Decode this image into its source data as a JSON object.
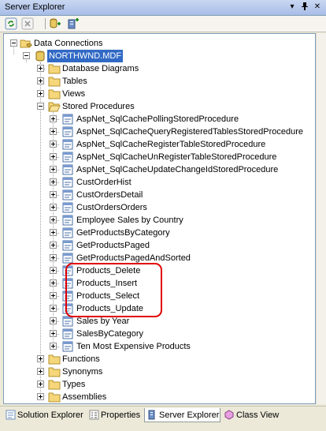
{
  "window": {
    "title": "Server Explorer"
  },
  "title_buttons": [
    "dropdown-icon",
    "pin-icon",
    "close-icon"
  ],
  "toolbar": {
    "buttons": [
      "refresh-icon",
      "stop-icon",
      "connect-database-icon",
      "connect-server-icon"
    ]
  },
  "tree": {
    "root": "Data Connections",
    "connection": "NORTHWND.MDF",
    "folders": {
      "database_diagrams": "Database Diagrams",
      "tables": "Tables",
      "views": "Views",
      "stored_procedures": "Stored Procedures",
      "functions": "Functions",
      "synonyms": "Synonyms",
      "types": "Types",
      "assemblies": "Assemblies"
    },
    "procedures": [
      "AspNet_SqlCachePollingStoredProcedure",
      "AspNet_SqlCacheQueryRegisteredTablesStoredProcedure",
      "AspNet_SqlCacheRegisterTableStoredProcedure",
      "AspNet_SqlCacheUnRegisterTableStoredProcedure",
      "AspNet_SqlCacheUpdateChangeIdStoredProcedure",
      "CustOrderHist",
      "CustOrdersDetail",
      "CustOrdersOrders",
      "Employee Sales by Country",
      "GetProductsByCategory",
      "GetProductsPaged",
      "GetProductsPagedAndSorted",
      "Products_Delete",
      "Products_Insert",
      "Products_Select",
      "Products_Update",
      "Sales by Year",
      "SalesByCategory",
      "Ten Most Expensive Products"
    ]
  },
  "tabs": [
    "Solution Explorer",
    "Properties",
    "Server Explorer",
    "Class View"
  ],
  "active_tab": "Server Explorer",
  "colors": {
    "highlight": "#e00000",
    "selection": "#316ac5"
  }
}
